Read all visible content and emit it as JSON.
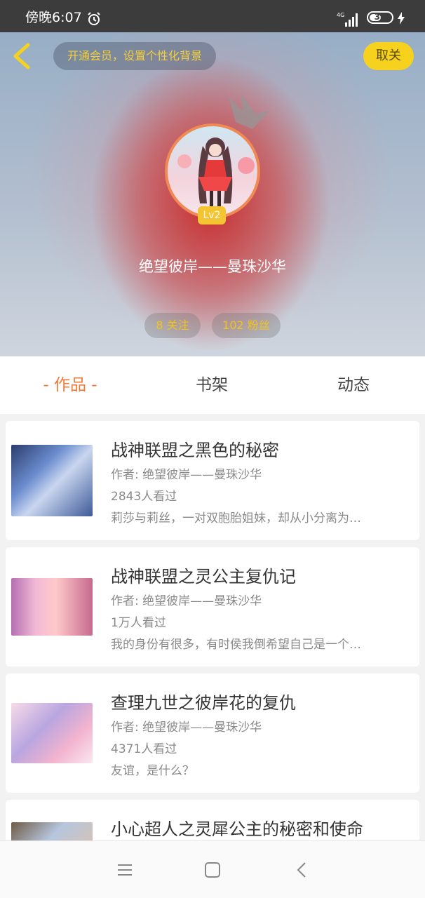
{
  "status_bar": {
    "time": "傍晚6:07",
    "network": "4G",
    "battery": "38",
    "icons": [
      "alarm-icon",
      "signal-icon",
      "battery-icon",
      "charge-icon"
    ]
  },
  "header": {
    "vip_banner": "开通会员，设置个性化背景",
    "unfollow_label": "取关",
    "level": "Lv2",
    "username": "绝望彼岸——曼珠沙华",
    "following": "8 关注",
    "fans": "102 粉丝"
  },
  "tabs": [
    {
      "label": "- 作品 -",
      "active": true
    },
    {
      "label": "书架",
      "active": false
    },
    {
      "label": "动态",
      "active": false
    }
  ],
  "works": [
    {
      "title": "战神联盟之黑色的秘密",
      "author": "作者: 绝望彼岸——曼珠沙华",
      "views": "2843人看过",
      "desc": "莉莎与莉丝，一对双胞胎姐妹，却从小分离为…"
    },
    {
      "title": "战神联盟之灵公主复仇记",
      "author": "作者: 绝望彼岸——曼珠沙华",
      "views": "1万人看过",
      "desc": "我的身份有很多，有时侯我倒希望自己是一个…"
    },
    {
      "title": "查理九世之彼岸花的复仇",
      "author": "作者: 绝望彼岸——曼珠沙华",
      "views": "4371人看过",
      "desc": "友谊，是什么？"
    },
    {
      "title": "小心超人之灵犀公主的秘密和使命",
      "author": "",
      "views": "",
      "desc": ""
    }
  ],
  "colors": {
    "accent": "#f07a3a",
    "gold": "#f0c419",
    "unfollow_bg": "#f6d21e",
    "level_badge": "#f4c431"
  }
}
